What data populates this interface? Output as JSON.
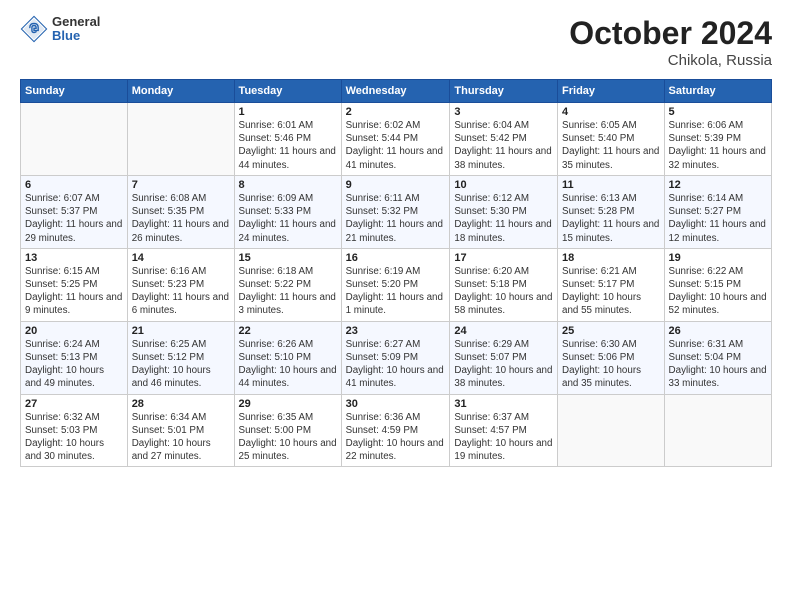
{
  "header": {
    "logo": {
      "general": "General",
      "blue": "Blue"
    },
    "title": "October 2024",
    "location": "Chikola, Russia"
  },
  "days_of_week": [
    "Sunday",
    "Monday",
    "Tuesday",
    "Wednesday",
    "Thursday",
    "Friday",
    "Saturday"
  ],
  "weeks": [
    [
      {
        "day": "",
        "sunrise": "",
        "sunset": "",
        "daylight": ""
      },
      {
        "day": "",
        "sunrise": "",
        "sunset": "",
        "daylight": ""
      },
      {
        "day": "1",
        "sunrise": "Sunrise: 6:01 AM",
        "sunset": "Sunset: 5:46 PM",
        "daylight": "Daylight: 11 hours and 44 minutes."
      },
      {
        "day": "2",
        "sunrise": "Sunrise: 6:02 AM",
        "sunset": "Sunset: 5:44 PM",
        "daylight": "Daylight: 11 hours and 41 minutes."
      },
      {
        "day": "3",
        "sunrise": "Sunrise: 6:04 AM",
        "sunset": "Sunset: 5:42 PM",
        "daylight": "Daylight: 11 hours and 38 minutes."
      },
      {
        "day": "4",
        "sunrise": "Sunrise: 6:05 AM",
        "sunset": "Sunset: 5:40 PM",
        "daylight": "Daylight: 11 hours and 35 minutes."
      },
      {
        "day": "5",
        "sunrise": "Sunrise: 6:06 AM",
        "sunset": "Sunset: 5:39 PM",
        "daylight": "Daylight: 11 hours and 32 minutes."
      }
    ],
    [
      {
        "day": "6",
        "sunrise": "Sunrise: 6:07 AM",
        "sunset": "Sunset: 5:37 PM",
        "daylight": "Daylight: 11 hours and 29 minutes."
      },
      {
        "day": "7",
        "sunrise": "Sunrise: 6:08 AM",
        "sunset": "Sunset: 5:35 PM",
        "daylight": "Daylight: 11 hours and 26 minutes."
      },
      {
        "day": "8",
        "sunrise": "Sunrise: 6:09 AM",
        "sunset": "Sunset: 5:33 PM",
        "daylight": "Daylight: 11 hours and 24 minutes."
      },
      {
        "day": "9",
        "sunrise": "Sunrise: 6:11 AM",
        "sunset": "Sunset: 5:32 PM",
        "daylight": "Daylight: 11 hours and 21 minutes."
      },
      {
        "day": "10",
        "sunrise": "Sunrise: 6:12 AM",
        "sunset": "Sunset: 5:30 PM",
        "daylight": "Daylight: 11 hours and 18 minutes."
      },
      {
        "day": "11",
        "sunrise": "Sunrise: 6:13 AM",
        "sunset": "Sunset: 5:28 PM",
        "daylight": "Daylight: 11 hours and 15 minutes."
      },
      {
        "day": "12",
        "sunrise": "Sunrise: 6:14 AM",
        "sunset": "Sunset: 5:27 PM",
        "daylight": "Daylight: 11 hours and 12 minutes."
      }
    ],
    [
      {
        "day": "13",
        "sunrise": "Sunrise: 6:15 AM",
        "sunset": "Sunset: 5:25 PM",
        "daylight": "Daylight: 11 hours and 9 minutes."
      },
      {
        "day": "14",
        "sunrise": "Sunrise: 6:16 AM",
        "sunset": "Sunset: 5:23 PM",
        "daylight": "Daylight: 11 hours and 6 minutes."
      },
      {
        "day": "15",
        "sunrise": "Sunrise: 6:18 AM",
        "sunset": "Sunset: 5:22 PM",
        "daylight": "Daylight: 11 hours and 3 minutes."
      },
      {
        "day": "16",
        "sunrise": "Sunrise: 6:19 AM",
        "sunset": "Sunset: 5:20 PM",
        "daylight": "Daylight: 11 hours and 1 minute."
      },
      {
        "day": "17",
        "sunrise": "Sunrise: 6:20 AM",
        "sunset": "Sunset: 5:18 PM",
        "daylight": "Daylight: 10 hours and 58 minutes."
      },
      {
        "day": "18",
        "sunrise": "Sunrise: 6:21 AM",
        "sunset": "Sunset: 5:17 PM",
        "daylight": "Daylight: 10 hours and 55 minutes."
      },
      {
        "day": "19",
        "sunrise": "Sunrise: 6:22 AM",
        "sunset": "Sunset: 5:15 PM",
        "daylight": "Daylight: 10 hours and 52 minutes."
      }
    ],
    [
      {
        "day": "20",
        "sunrise": "Sunrise: 6:24 AM",
        "sunset": "Sunset: 5:13 PM",
        "daylight": "Daylight: 10 hours and 49 minutes."
      },
      {
        "day": "21",
        "sunrise": "Sunrise: 6:25 AM",
        "sunset": "Sunset: 5:12 PM",
        "daylight": "Daylight: 10 hours and 46 minutes."
      },
      {
        "day": "22",
        "sunrise": "Sunrise: 6:26 AM",
        "sunset": "Sunset: 5:10 PM",
        "daylight": "Daylight: 10 hours and 44 minutes."
      },
      {
        "day": "23",
        "sunrise": "Sunrise: 6:27 AM",
        "sunset": "Sunset: 5:09 PM",
        "daylight": "Daylight: 10 hours and 41 minutes."
      },
      {
        "day": "24",
        "sunrise": "Sunrise: 6:29 AM",
        "sunset": "Sunset: 5:07 PM",
        "daylight": "Daylight: 10 hours and 38 minutes."
      },
      {
        "day": "25",
        "sunrise": "Sunrise: 6:30 AM",
        "sunset": "Sunset: 5:06 PM",
        "daylight": "Daylight: 10 hours and 35 minutes."
      },
      {
        "day": "26",
        "sunrise": "Sunrise: 6:31 AM",
        "sunset": "Sunset: 5:04 PM",
        "daylight": "Daylight: 10 hours and 33 minutes."
      }
    ],
    [
      {
        "day": "27",
        "sunrise": "Sunrise: 6:32 AM",
        "sunset": "Sunset: 5:03 PM",
        "daylight": "Daylight: 10 hours and 30 minutes."
      },
      {
        "day": "28",
        "sunrise": "Sunrise: 6:34 AM",
        "sunset": "Sunset: 5:01 PM",
        "daylight": "Daylight: 10 hours and 27 minutes."
      },
      {
        "day": "29",
        "sunrise": "Sunrise: 6:35 AM",
        "sunset": "Sunset: 5:00 PM",
        "daylight": "Daylight: 10 hours and 25 minutes."
      },
      {
        "day": "30",
        "sunrise": "Sunrise: 6:36 AM",
        "sunset": "Sunset: 4:59 PM",
        "daylight": "Daylight: 10 hours and 22 minutes."
      },
      {
        "day": "31",
        "sunrise": "Sunrise: 6:37 AM",
        "sunset": "Sunset: 4:57 PM",
        "daylight": "Daylight: 10 hours and 19 minutes."
      },
      {
        "day": "",
        "sunrise": "",
        "sunset": "",
        "daylight": ""
      },
      {
        "day": "",
        "sunrise": "",
        "sunset": "",
        "daylight": ""
      }
    ]
  ]
}
